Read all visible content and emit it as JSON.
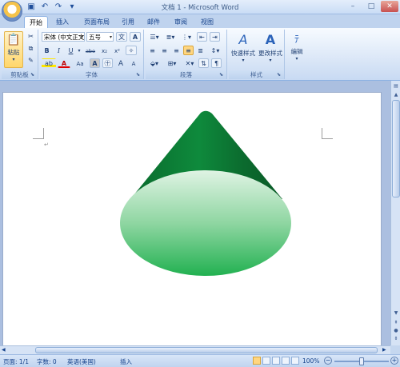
{
  "window": {
    "title": "文档 1 - Microsoft Word"
  },
  "quick_access": {
    "save_icon": "save-icon",
    "undo_icon": "undo-icon",
    "redo_icon": "redo-icon"
  },
  "tabs": [
    {
      "label": "开始",
      "active": true
    },
    {
      "label": "插入",
      "active": false
    },
    {
      "label": "页面布局",
      "active": false
    },
    {
      "label": "引用",
      "active": false
    },
    {
      "label": "邮件",
      "active": false
    },
    {
      "label": "审阅",
      "active": false
    },
    {
      "label": "视图",
      "active": false
    }
  ],
  "ribbon": {
    "clipboard": {
      "group_label": "剪贴板",
      "paste_label": "粘贴"
    },
    "font": {
      "group_label": "字体",
      "font_name": "宋体 (中文正文)",
      "font_size": "五号",
      "bold": "B",
      "italic": "I",
      "underline": "U",
      "strike": "abe",
      "subscript": "x₂",
      "superscript": "x²",
      "change_case": "Aa",
      "grow": "A",
      "shrink": "A",
      "pinyin": "文"
    },
    "paragraph": {
      "group_label": "段落"
    },
    "styles": {
      "group_label": "样式",
      "quick_styles": "快速样式",
      "change_styles": "更改样式"
    },
    "editing": {
      "label": "编辑"
    }
  },
  "document": {
    "paragraph_mark": "↵"
  },
  "status": {
    "page": "页面: 1/1",
    "words": "字数: 0",
    "language": "英语(美国)",
    "mode": "插入",
    "zoom": "100%",
    "zoom_level": 1.0
  },
  "colors": {
    "accent": "#15428b",
    "cone_dark": "#0b6a2e",
    "cone_light": "#d9f1e0",
    "cone_base": "#2bb457"
  }
}
